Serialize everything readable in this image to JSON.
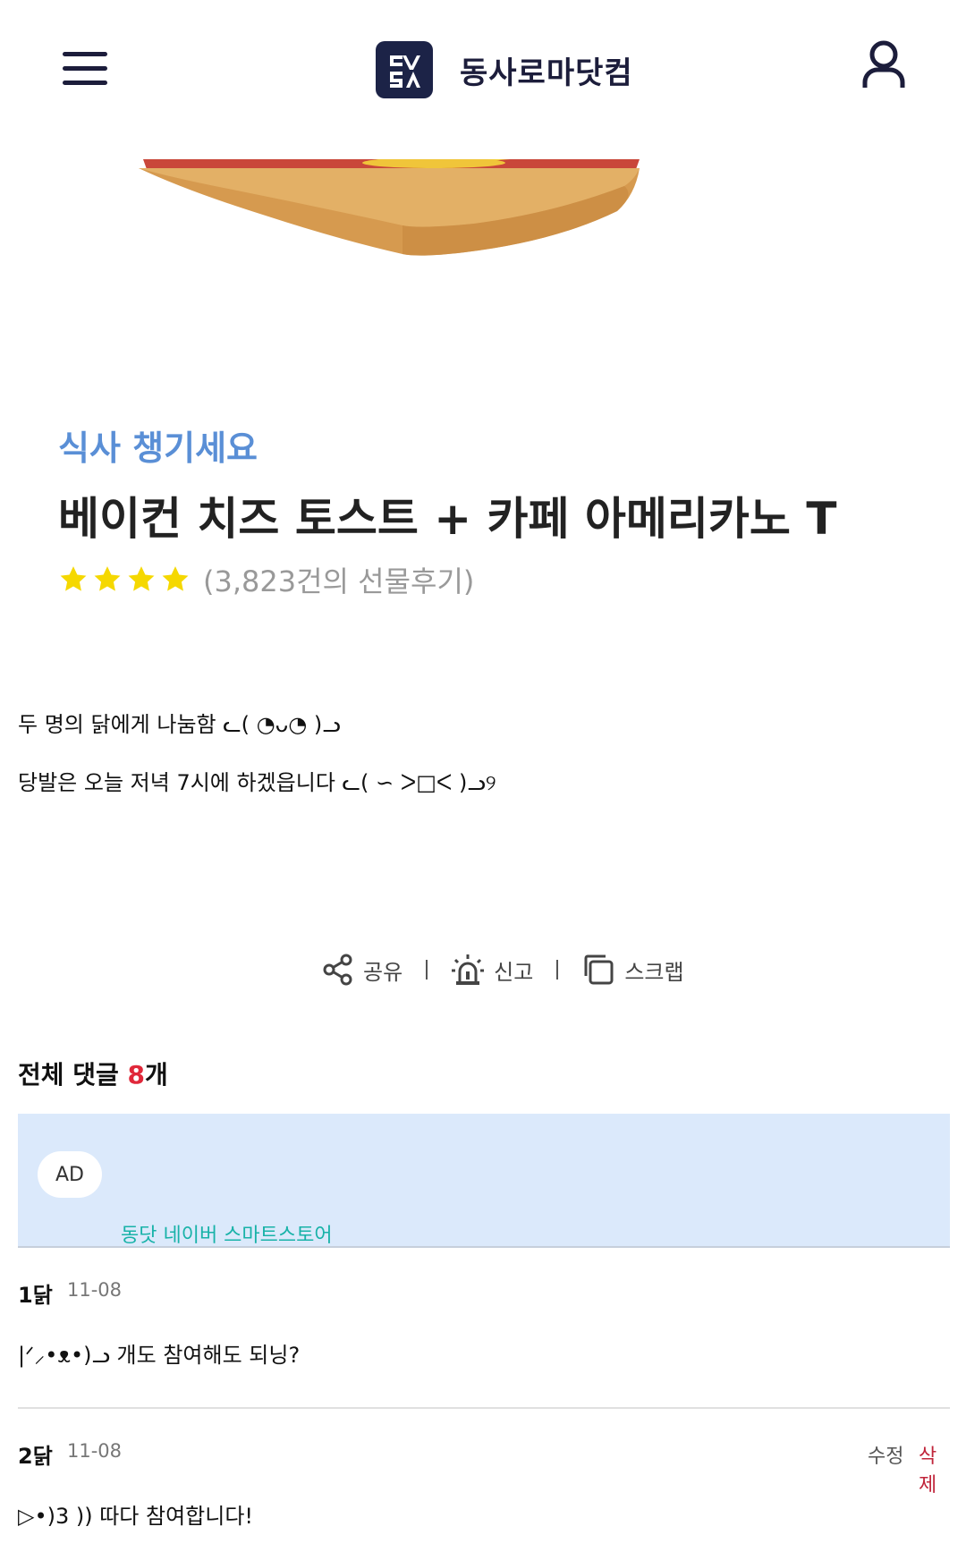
{
  "header": {
    "site_title": "동사로마닷컴",
    "logo_text": "동사"
  },
  "product": {
    "category": "식사 챙기세요",
    "title": "베이컨 치즈 토스트 + 카페 아메리카노 T",
    "rating": 4,
    "review_count": "(3,823건의 선물후기)"
  },
  "post": {
    "line1": "두 명의 닭에게 나눔함 ᓚ( ◔ᴗ◔ )ᓗ",
    "line2": "당발은 오늘 저녁 7시에 하겠읍니다 ᓚ( ∽ ᐳ□ᐸ )ᓗ୨"
  },
  "actions": {
    "share": "공유",
    "report": "신고",
    "scrap": "스크랩"
  },
  "comments_section": {
    "title": "전체 댓글",
    "count": "8",
    "suffix": "개"
  },
  "ad": {
    "badge": "AD",
    "link": "동닷 네이버 스마트스토어"
  },
  "comments": [
    {
      "author": "1닭",
      "date": "11-08",
      "text": "|ᐟ⸝•ᴥ•)ᓗ 개도 참여해도 되닝?"
    },
    {
      "author": "2닭",
      "date": "11-08",
      "text": "▷•)3 )) 따다 참여합니다!",
      "edit": "수정",
      "delete": "삭제"
    }
  ],
  "colors": {
    "accent_blue": "#5a8fd6",
    "count_red": "#e0283a",
    "ad_bg": "#dbe9fb",
    "ad_link": "#18b2a8",
    "star": "#f5d800",
    "navy": "#1c2347"
  }
}
